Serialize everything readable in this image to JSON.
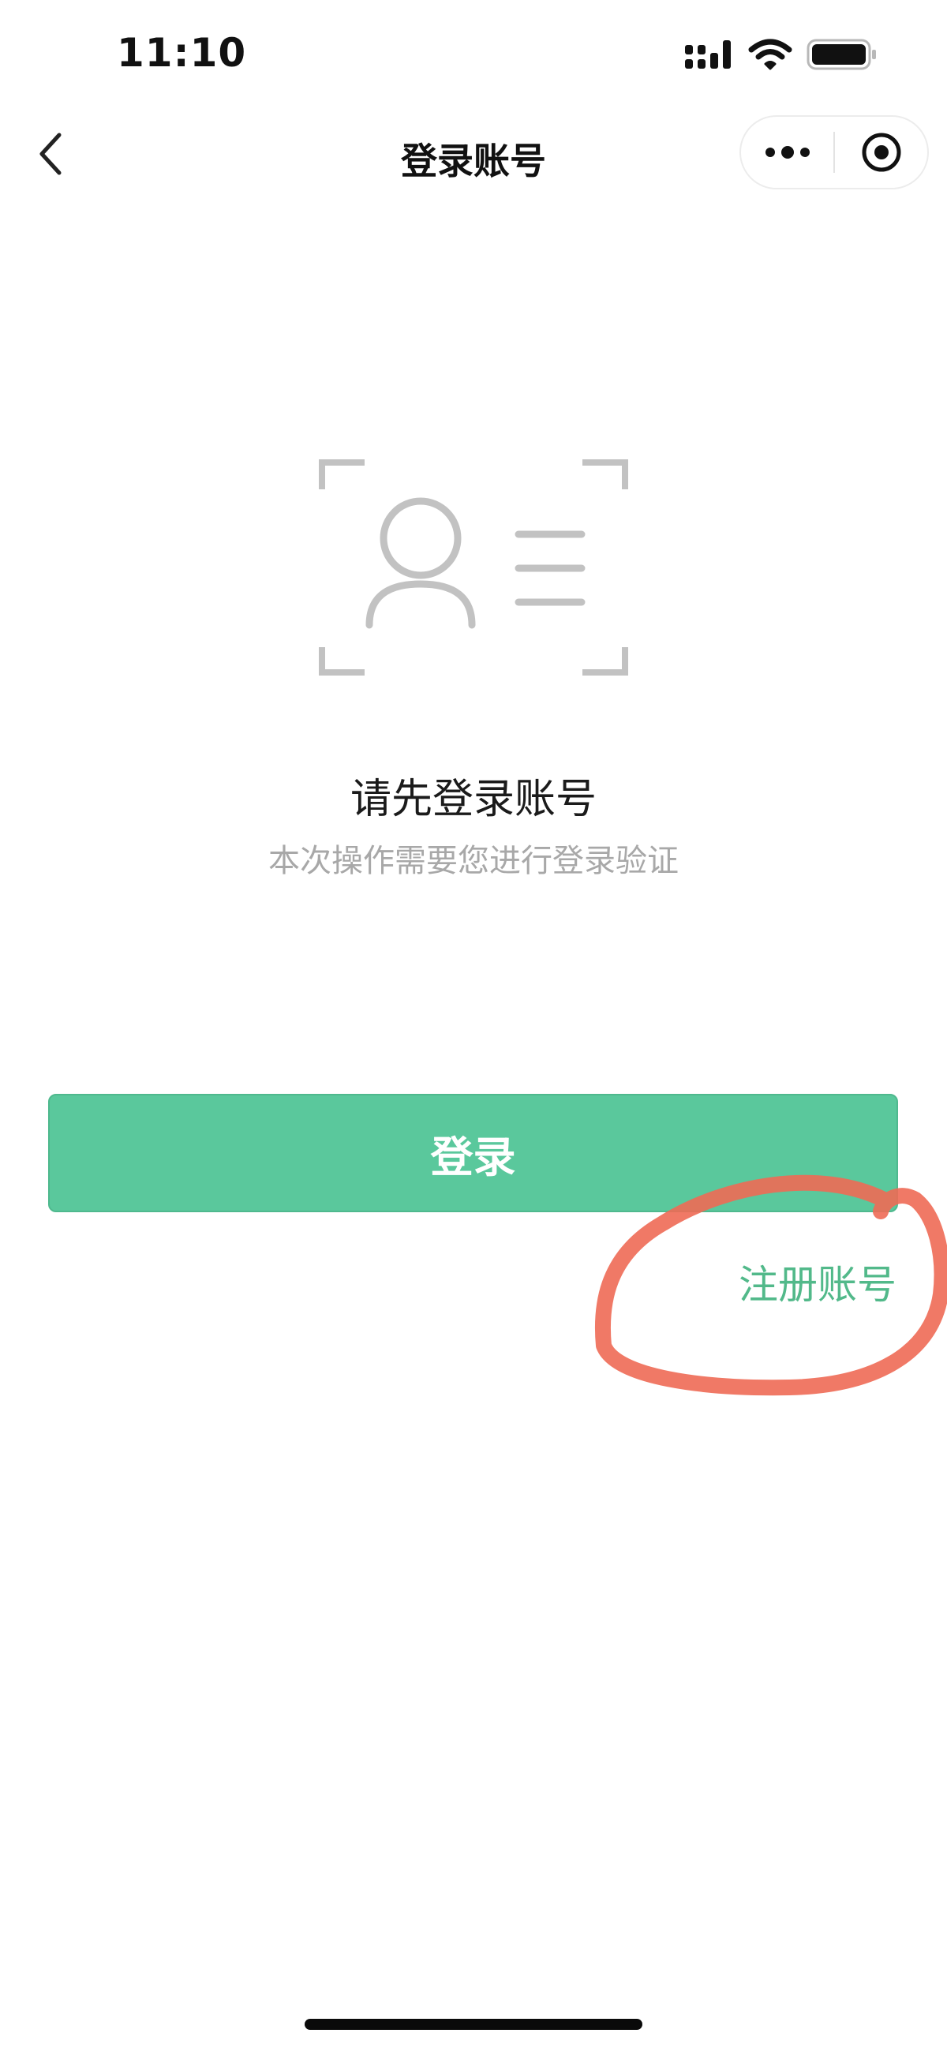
{
  "status_bar": {
    "time": "11:10",
    "icons": [
      "signal-icon",
      "wifi-icon",
      "battery-icon"
    ]
  },
  "nav": {
    "title": "登录账号",
    "back_icon": "chevron-left-icon",
    "capsule_icons": [
      "more-icon",
      "target-icon"
    ]
  },
  "main": {
    "illustration_icon": "user-id-card-icon",
    "title": "请先登录账号",
    "subtitle": "本次操作需要您进行登录验证",
    "login_label": "登录",
    "register_label": "注册账号"
  },
  "colors": {
    "accent": "#5ac89c",
    "link": "#52b98a",
    "annotation": "#ee6a55"
  }
}
